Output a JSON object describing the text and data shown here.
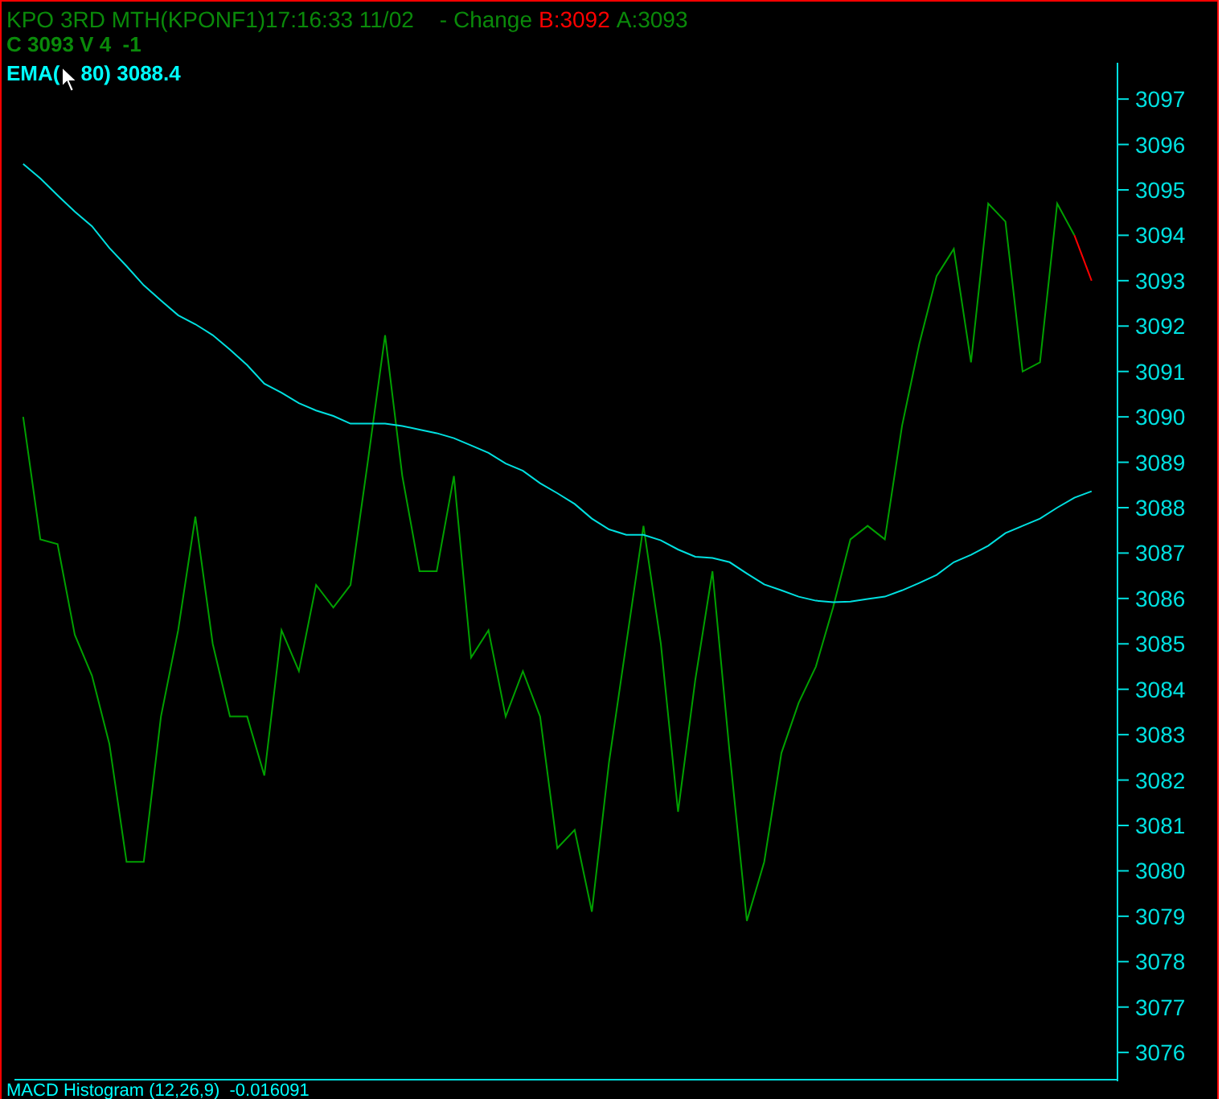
{
  "header": {
    "title": "KPO 3RD MTH(KPONF1)17:16:33 11/02",
    "change_label": "- Change",
    "bid": "B:3092",
    "ask": "A:3093",
    "last": "C 3093 V 4  -1"
  },
  "indicator": {
    "label_start": "EMA(",
    "label_end": "80) 3088.4"
  },
  "chart": {
    "chart_data": {
      "type": "line",
      "categories": [
        null,
        null,
        null,
        null,
        null,
        null,
        null,
        null,
        null,
        null,
        null,
        null,
        null,
        null,
        null,
        null,
        null,
        null,
        null,
        null,
        null,
        null,
        null,
        null,
        null,
        null,
        null,
        null,
        null,
        null,
        null,
        null,
        null,
        null,
        null,
        null,
        null,
        null,
        null,
        null,
        null,
        null,
        null,
        null,
        null,
        null,
        null,
        null,
        null,
        null,
        null,
        null,
        null,
        null,
        null,
        null,
        null,
        null,
        null,
        null,
        null,
        null,
        null,
        null
      ],
      "ylim": [
        3075.4,
        3097.8
      ],
      "yticks": [
        3076,
        3077,
        3078,
        3079,
        3080,
        3081,
        3082,
        3083,
        3084,
        3085,
        3086,
        3087,
        3088,
        3089,
        3090,
        3091,
        3092,
        3093,
        3094,
        3095,
        3096,
        3097
      ],
      "series": [
        {
          "color": "#00a000",
          "values": [
            3090,
            3087.3,
            3087.2,
            3085.2,
            3084.3,
            3082.8,
            3080.2,
            3080.2,
            3083.4,
            3085.3,
            3087.8,
            3085,
            3083.4,
            3083.4,
            3082.1,
            3085.3,
            3084.4,
            3086.3,
            3085.8,
            3086.3,
            3089,
            3091.8,
            3088.7,
            3086.6,
            3086.6,
            3088.7,
            3084.7,
            3085.3,
            3083.4,
            3084.4,
            3083.4,
            3080.5,
            3080.9,
            3079.1,
            3082.4,
            3085,
            3087.6,
            3085,
            3081.3,
            3084.2,
            3086.6,
            3082.6,
            3078.9,
            3080.2,
            3082.6,
            3083.7,
            3084.5,
            3085.8,
            3087.3,
            3087.6,
            3087.3,
            3089.8,
            3091.6,
            3093.1,
            3093.7,
            3091.2,
            3094.7,
            3094.3,
            3091,
            3091.2,
            3094.7,
            3094,
            null,
            null
          ]
        },
        {
          "color": "#ff0000",
          "values": [
            null,
            null,
            null,
            null,
            null,
            null,
            null,
            null,
            null,
            null,
            null,
            null,
            null,
            null,
            null,
            null,
            null,
            null,
            null,
            null,
            null,
            null,
            null,
            null,
            null,
            null,
            null,
            null,
            null,
            null,
            null,
            null,
            null,
            null,
            null,
            null,
            null,
            null,
            null,
            null,
            null,
            null,
            null,
            null,
            null,
            null,
            null,
            null,
            null,
            null,
            null,
            null,
            null,
            null,
            null,
            null,
            null,
            null,
            null,
            null,
            null,
            3094,
            3093,
            null
          ]
        },
        {
          "color": "#00e0e0",
          "values": [
            3095.57,
            3095.25,
            3094.88,
            3094.52,
            3094.2,
            3093.72,
            3093.32,
            3092.9,
            3092.56,
            3092.24,
            3092.04,
            3091.8,
            3091.48,
            3091.14,
            3090.73,
            3090.53,
            3090.3,
            3090.14,
            3090.02,
            3089.85,
            3089.85,
            3089.85,
            3089.8,
            3089.72,
            3089.64,
            3089.53,
            3089.37,
            3089.21,
            3088.97,
            3088.81,
            3088.54,
            3088.32,
            3088.08,
            3087.76,
            3087.52,
            3087.4,
            3087.4,
            3087.28,
            3087.08,
            3086.92,
            3086.89,
            3086.8,
            3086.55,
            3086.31,
            3086.18,
            3086.04,
            3085.95,
            3085.92,
            3085.93,
            3085.99,
            3086.04,
            3086.18,
            3086.34,
            3086.52,
            3086.8,
            3086.96,
            3087.16,
            3087.44,
            3087.6,
            3087.76,
            3088.0,
            3088.22,
            3088.36,
            null
          ]
        }
      ]
    }
  },
  "footer": {
    "label": "MACD Histogram (12,26,9)  -0.016091"
  }
}
